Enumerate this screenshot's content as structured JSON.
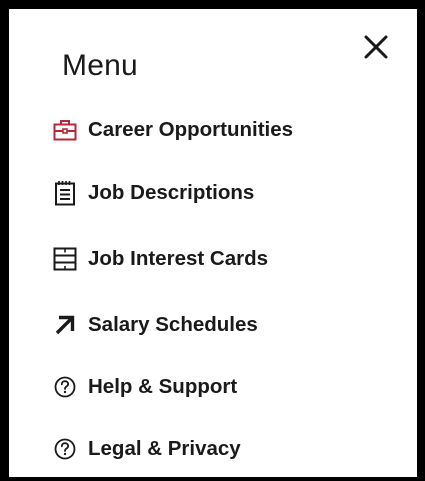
{
  "menu": {
    "title": "Menu",
    "close_icon": "close-icon",
    "items": [
      {
        "label": "Career Opportunities",
        "icon": "briefcase-icon",
        "icon_color": "#b22a3a"
      },
      {
        "label": "Job Descriptions",
        "icon": "notepad-icon",
        "icon_color": "#1a1a1a"
      },
      {
        "label": "Job Interest Cards",
        "icon": "card-list-icon",
        "icon_color": "#1a1a1a"
      },
      {
        "label": "Salary Schedules",
        "icon": "arrow-up-right-icon",
        "icon_color": "#1a1a1a"
      },
      {
        "label": "Help & Support",
        "icon": "question-circle-icon",
        "icon_color": "#1a1a1a"
      },
      {
        "label": "Legal & Privacy",
        "icon": "question-circle-icon",
        "icon_color": "#1a1a1a"
      }
    ]
  },
  "colors": {
    "text": "#1a1a1a",
    "accent": "#b22a3a",
    "border": "#000000",
    "background": "#ffffff"
  }
}
